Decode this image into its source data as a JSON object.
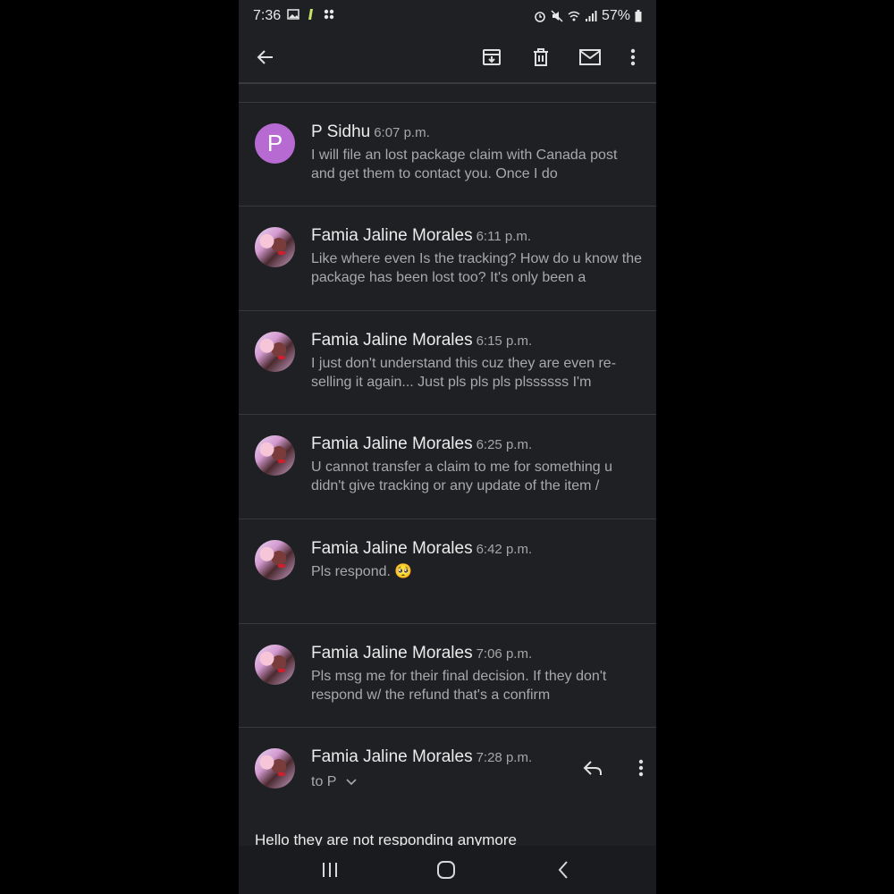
{
  "status_bar": {
    "time": "7:36",
    "battery": "57%",
    "left_icons": [
      "image-icon",
      "pen-icon",
      "apps-icon"
    ],
    "right_icons": [
      "alarm-icon",
      "mute-icon",
      "wifi-icon",
      "signal-icon",
      "battery-icon"
    ]
  },
  "app_bar": {
    "icons": [
      "back-arrow-icon",
      "archive-icon",
      "delete-icon",
      "mark-unread-icon",
      "more-vert-icon"
    ]
  },
  "messages": [
    {
      "sender": "P Sidhu",
      "time": "6:07 p.m.",
      "avatar": "P",
      "snippet": "I will file an lost package claim with Canada post and get them to contact you. Once I do"
    },
    {
      "sender": "Famia Jaline Morales",
      "time": "6:11 p.m.",
      "snippet": "Like where even Is the tracking? How do u know the package has been lost too? It's only been a"
    },
    {
      "sender": "Famia Jaline Morales",
      "time": "6:15 p.m.",
      "snippet": "I just don't understand this cuz they are even re-selling it again... Just pls pls pls plssssss I'm"
    },
    {
      "sender": "Famia Jaline Morales",
      "time": "6:25 p.m.",
      "snippet": "U cannot transfer a claim to me for something u didn't give tracking or any update of the item /"
    },
    {
      "sender": "Famia Jaline Morales",
      "time": "6:42 p.m.",
      "snippet": "Pls respond. 🥺"
    },
    {
      "sender": "Famia Jaline Morales",
      "time": "7:06 p.m.",
      "snippet": "Pls msg me for their final decision. If they don't respond w/ the refund that's a confirm"
    }
  ],
  "open_message": {
    "sender": "Famia Jaline Morales",
    "time": "7:28 p.m.",
    "to": "to P",
    "body": "Hello they are not responding anymore"
  },
  "nav_bar": {
    "icons": [
      "recents-icon",
      "home-icon",
      "back-icon"
    ]
  }
}
